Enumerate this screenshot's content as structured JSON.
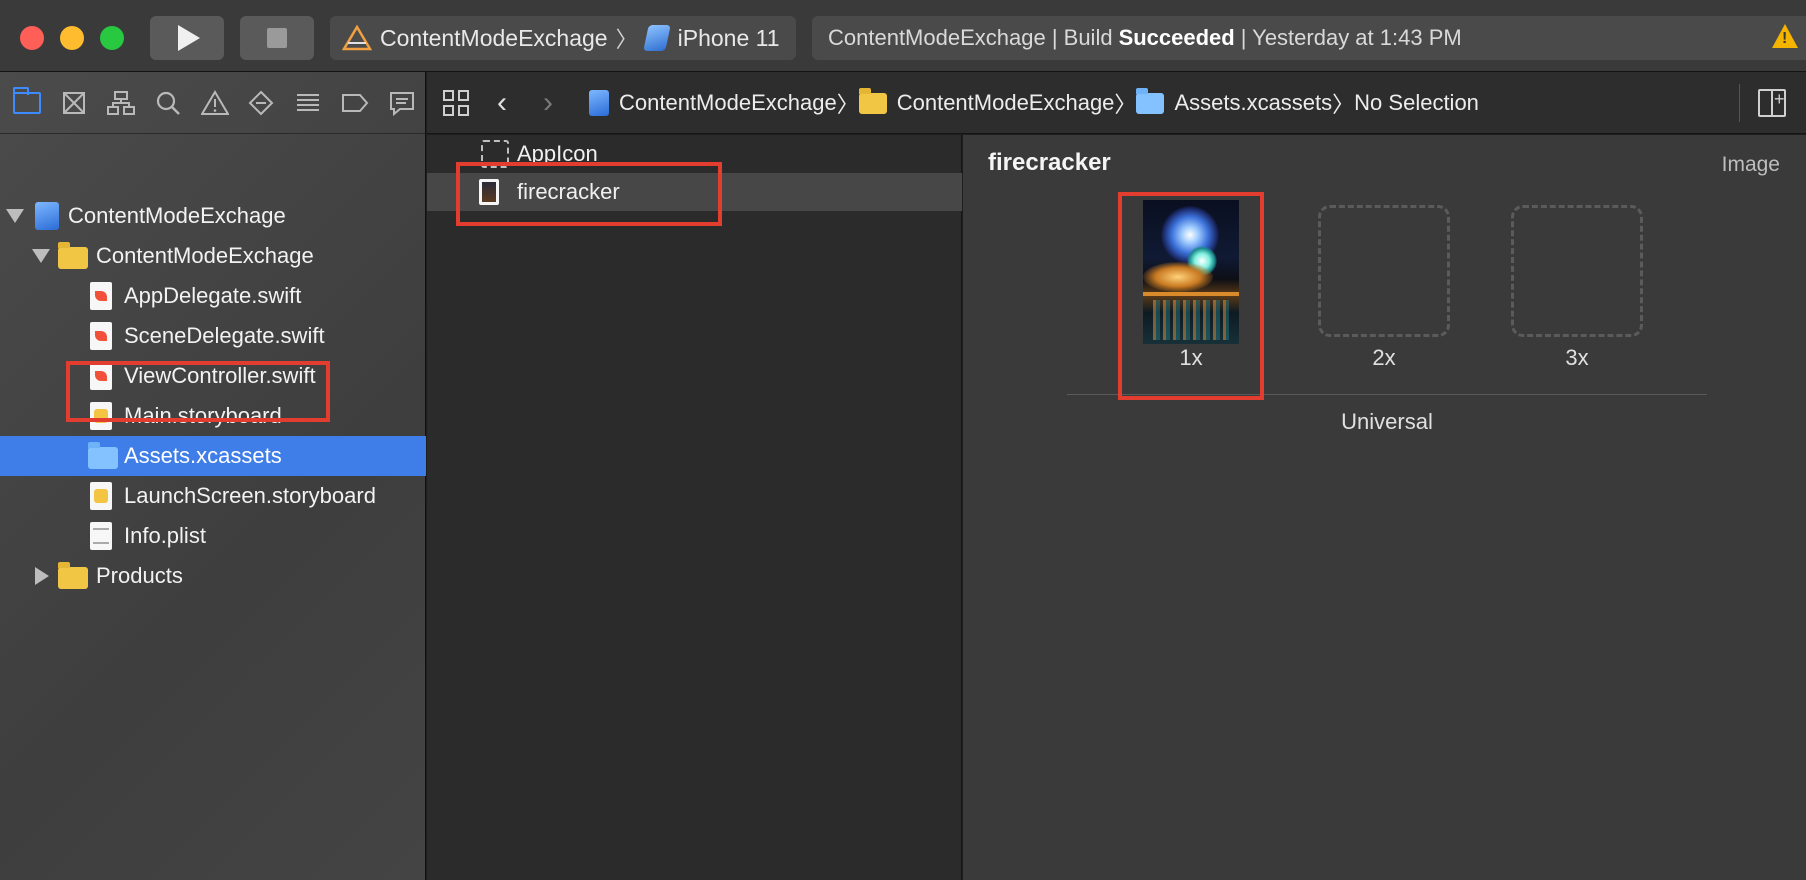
{
  "toolbar": {
    "scheme": {
      "project": "ContentModeExchage",
      "device": "iPhone 11"
    },
    "activity": {
      "prefix": "ContentModeExchage | Build",
      "status": "Succeeded",
      "suffix": "| Yesterday at 1:43 PM"
    }
  },
  "navigator": {
    "tabs": [
      "folder-icon",
      "source-control-icon",
      "symbol-icon",
      "find-icon",
      "issue-icon",
      "test-icon",
      "debug-icon",
      "breakpoint-icon",
      "report-icon"
    ],
    "tree": {
      "project": "ContentModeExchage",
      "group": "ContentModeExchage",
      "files": [
        "AppDelegate.swift",
        "SceneDelegate.swift",
        "ViewController.swift",
        "Main.storyboard",
        "Assets.xcassets",
        "LaunchScreen.storyboard",
        "Info.plist"
      ],
      "products": "Products"
    },
    "selected": "Assets.xcassets"
  },
  "jumpbar": {
    "crumbs": [
      "ContentModeExchage",
      "ContentModeExchage",
      "Assets.xcassets",
      "No Selection"
    ]
  },
  "assets": {
    "items": [
      "AppIcon",
      "firecracker"
    ],
    "selected": "firecracker"
  },
  "detail": {
    "title": "firecracker",
    "kind": "Image",
    "slots": [
      "1x",
      "2x",
      "3x"
    ],
    "group_label": "Universal"
  },
  "colors": {
    "selection": "#3f7ee8",
    "annotation": "#e23d2e",
    "warning": "#f5b400"
  }
}
